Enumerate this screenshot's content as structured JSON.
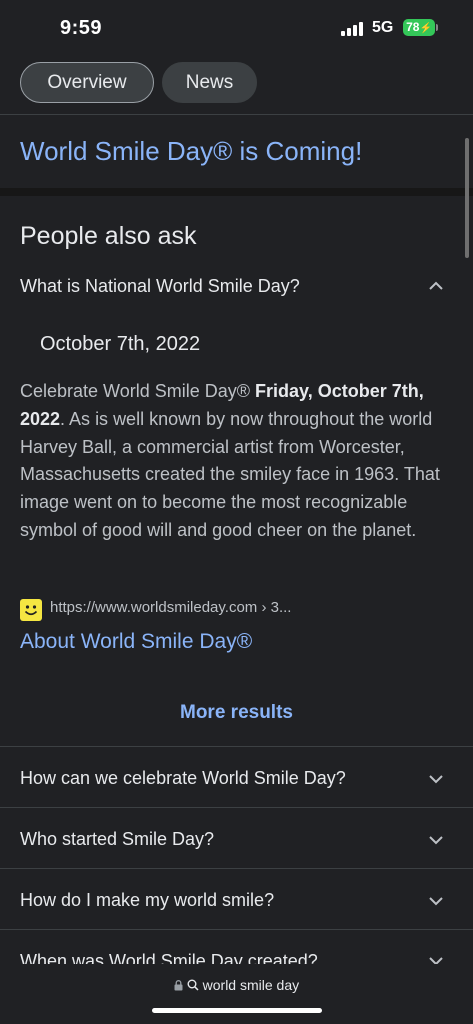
{
  "status_bar": {
    "time": "9:59",
    "network": "5G",
    "battery": "78"
  },
  "tabs": [
    {
      "label": "Overview"
    },
    {
      "label": "News"
    }
  ],
  "result_title": "World Smile Day® is Coming!",
  "people_also_ask": {
    "heading": "People also ask",
    "expanded_question": "What is National World Smile Day?",
    "answer": {
      "date": "October 7th, 2022",
      "text_before": "Celebrate World Smile Day® ",
      "bold": "Friday, October 7th, 2022",
      "text_after": ". As is well known by now throughout the world Harvey Ball, a commercial artist from Worcester, Massachusetts created the smiley face in 1963. That image went on to become the most recognizable symbol of good will and good cheer on the planet.",
      "source_url": "https://www.worldsmileday.com › 3...",
      "source_title": "About World Smile Day®"
    },
    "more_results": "More results",
    "questions": [
      "How can we celebrate World Smile Day?",
      "Who started Smile Day?",
      "How do I make my world smile?",
      "When was World Smile Day created?"
    ]
  },
  "address_bar": {
    "text": "world smile day"
  },
  "colors": {
    "background": "#202124",
    "link": "#8ab4f8",
    "battery": "#34c759"
  }
}
